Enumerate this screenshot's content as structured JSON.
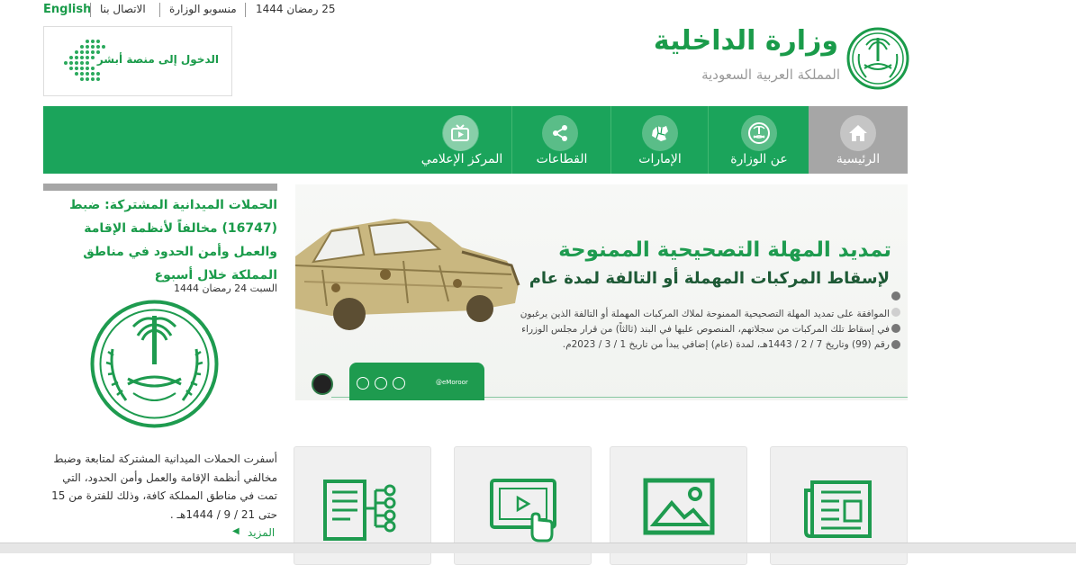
{
  "topbar": {
    "english": "English",
    "contact": "الاتصال بنا",
    "employees": "منسوبو الوزارة",
    "date": "25 رمضان 1444"
  },
  "header": {
    "title": "وزارة الداخلية",
    "subtitle": "المملكة العربية السعودية",
    "absher_label": "الدخول إلى منصة أبشر"
  },
  "nav": {
    "items": [
      {
        "label": "الرئيسية",
        "icon": "home-icon"
      },
      {
        "label": "عن الوزارة",
        "icon": "emblem-icon"
      },
      {
        "label": "الإمارات",
        "icon": "map-icon"
      },
      {
        "label": "القطاعات",
        "icon": "share-icon"
      },
      {
        "label": "المركز الإعلامي",
        "icon": "tv-icon"
      }
    ]
  },
  "news": {
    "title": "الحملات الميدانية المشتركة: ضبط (16747) مخالفاً لأنظمة الإقامة والعمل وأمن الحدود في مناطق المملكة خلال أسبوع",
    "date": "السبت 24 رمضان 1444",
    "body": "أسفرت الحملات الميدانية المشتركة لمتابعة وضبط مخالفي أنظمة الإقامة والعمل وأمن الحدود، التي تمت في مناطق المملكة كافة، وذلك للفترة من 15 حتى 21 / 9 / 1444هـ .",
    "more": "المزيد"
  },
  "banner": {
    "heading": "تمديد المهلة التصحيحية الممنوحة",
    "subheading": "لإسقاط المركبات المهملة أو التالفة لمدة عام",
    "body": "الموافقة على تمديد المهلة التصحيحية الممنوحة لملاك المركبات المهملة أو التالفة الذين يرغبون في إسقاط تلك المركبات من سجلاتهم، المنصوص عليها في البند (ثالثاً) من قرار مجلس الوزراء رقم (99) وتاريخ 7 / 2 / 1443هـ، لمدة (عام) إضافي يبدأ من تاريخ 1 / 3 / 2023م.",
    "handle": "@eMoroor"
  },
  "tiles": [
    {
      "icon": "news-icon"
    },
    {
      "icon": "image-icon"
    },
    {
      "icon": "video-icon"
    },
    {
      "icon": "services-icon"
    }
  ],
  "colors": {
    "brand_green": "#1ba45b",
    "home_gray": "#a6a6a6"
  }
}
